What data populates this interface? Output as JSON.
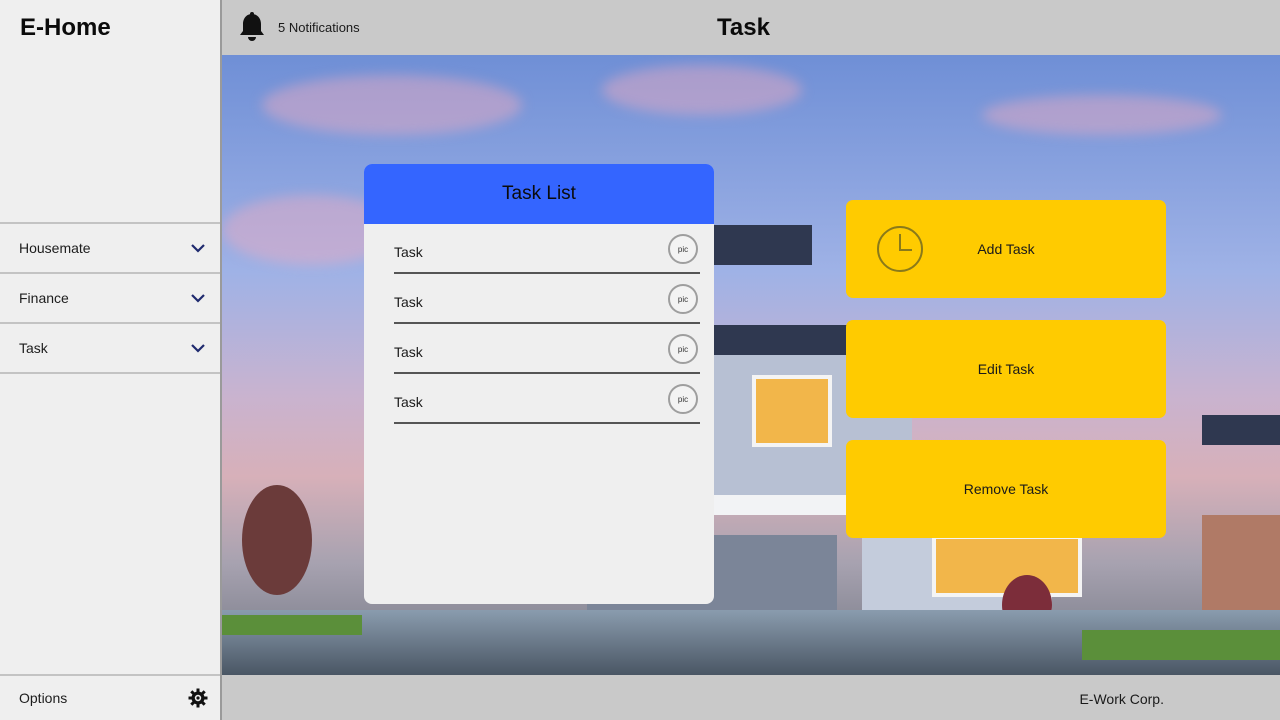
{
  "app": {
    "brand": "E-Home"
  },
  "header": {
    "notifications_label": "5 Notifications",
    "page_title": "Task",
    "bell_icon": "bell-icon"
  },
  "sidebar": {
    "items": [
      {
        "label": "Housemate",
        "icon": "chevron-down-icon"
      },
      {
        "label": "Finance",
        "icon": "chevron-down-icon"
      },
      {
        "label": "Task",
        "icon": "chevron-down-icon"
      }
    ],
    "footer": {
      "label": "Options",
      "icon": "gear-icon"
    }
  },
  "task_list": {
    "title": "Task List",
    "rows": [
      {
        "label": "Task",
        "avatar": "pic"
      },
      {
        "label": "Task",
        "avatar": "pic"
      },
      {
        "label": "Task",
        "avatar": "pic"
      },
      {
        "label": "Task",
        "avatar": "pic"
      }
    ]
  },
  "actions": {
    "add": "Add Task",
    "edit": "Edit Task",
    "remove": "Remove Task"
  },
  "footer": {
    "company": "E-Work Corp."
  },
  "colors": {
    "accent_blue": "#3465ff",
    "action_yellow": "#ffcb00",
    "chevron_navy": "#1f2a6e"
  }
}
